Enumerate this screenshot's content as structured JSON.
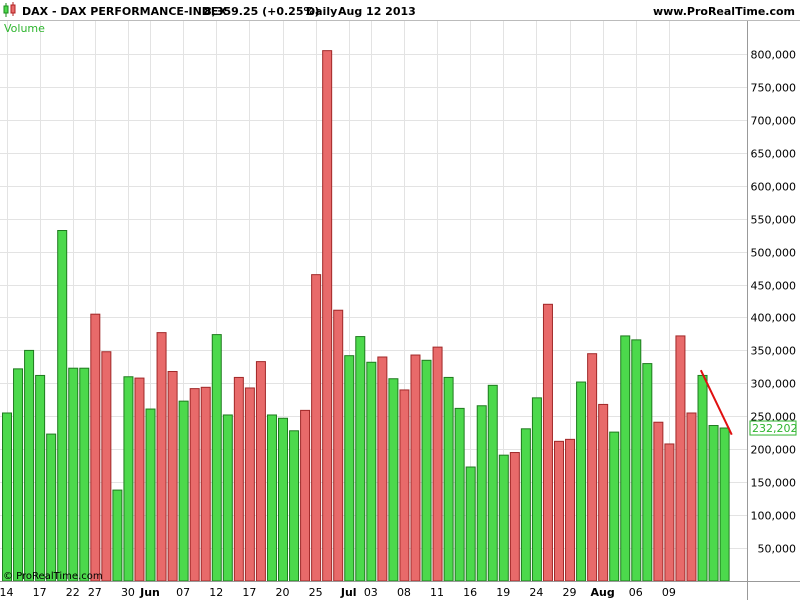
{
  "header": {
    "instrument": "DAX - DAX PERFORMANCE-INDEX",
    "price": "8,359.25 (+0.25%)",
    "period": "Daily",
    "date": "Aug 12 2013",
    "site": "www.ProRealTime.com"
  },
  "watermark": "© ProRealTime.com",
  "colors": {
    "up": "#4cd94c",
    "down": "#e86a6a",
    "trend": "#e01010",
    "grid": "#e3e3e3",
    "label_green": "#2fb52f"
  },
  "chart_data": {
    "type": "bar",
    "panel_label": "Volume",
    "ylim": [
      0,
      850000
    ],
    "y_ticks": [
      "50,000",
      "100,000",
      "150,000",
      "200,000",
      "250,000",
      "300,000",
      "350,000",
      "400,000",
      "450,000",
      "500,000",
      "550,000",
      "600,000",
      "650,000",
      "700,000",
      "750,000",
      "800,000"
    ],
    "y_tick_values": [
      50000,
      100000,
      150000,
      200000,
      250000,
      300000,
      350000,
      400000,
      450000,
      500000,
      550000,
      600000,
      650000,
      700000,
      750000,
      800000
    ],
    "x_tick_labels": [
      {
        "label": "14",
        "index": 0,
        "bold": false
      },
      {
        "label": "17",
        "index": 3,
        "bold": false
      },
      {
        "label": "22",
        "index": 6,
        "bold": false
      },
      {
        "label": "27",
        "index": 8,
        "bold": false
      },
      {
        "label": "30",
        "index": 11,
        "bold": false
      },
      {
        "label": "Jun",
        "index": 13,
        "bold": true
      },
      {
        "label": "07",
        "index": 16,
        "bold": false
      },
      {
        "label": "12",
        "index": 19,
        "bold": false
      },
      {
        "label": "17",
        "index": 22,
        "bold": false
      },
      {
        "label": "20",
        "index": 25,
        "bold": false
      },
      {
        "label": "25",
        "index": 28,
        "bold": false
      },
      {
        "label": "Jul",
        "index": 31,
        "bold": true
      },
      {
        "label": "03",
        "index": 33,
        "bold": false
      },
      {
        "label": "08",
        "index": 36,
        "bold": false
      },
      {
        "label": "11",
        "index": 39,
        "bold": false
      },
      {
        "label": "16",
        "index": 42,
        "bold": false
      },
      {
        "label": "19",
        "index": 45,
        "bold": false
      },
      {
        "label": "24",
        "index": 48,
        "bold": false
      },
      {
        "label": "29",
        "index": 51,
        "bold": false
      },
      {
        "label": "Aug",
        "index": 54,
        "bold": true
      },
      {
        "label": "06",
        "index": 57,
        "bold": false
      },
      {
        "label": "09",
        "index": 60,
        "bold": false
      }
    ],
    "values": [
      255000,
      322000,
      350000,
      312000,
      223000,
      532000,
      323000,
      323000,
      405000,
      348000,
      138000,
      310000,
      308000,
      261000,
      377000,
      318000,
      273000,
      292000,
      294000,
      374000,
      252000,
      309000,
      293000,
      333000,
      252000,
      247000,
      228000,
      259000,
      465000,
      805000,
      411000,
      342000,
      371000,
      332000,
      340000,
      307000,
      290000,
      343000,
      335000,
      355000,
      309000,
      262000,
      173000,
      266000,
      297000,
      191000,
      195000,
      231000,
      278000,
      420000,
      212000,
      215000,
      302000,
      345000,
      268000,
      226000,
      372000,
      366000,
      330000,
      241000,
      208000,
      372000,
      255000,
      312000,
      236000,
      232202
    ],
    "colors": [
      "up",
      "up",
      "up",
      "up",
      "up",
      "up",
      "up",
      "up",
      "down",
      "down",
      "up",
      "up",
      "down",
      "up",
      "down",
      "down",
      "up",
      "down",
      "down",
      "up",
      "up",
      "down",
      "down",
      "down",
      "up",
      "up",
      "up",
      "down",
      "down",
      "down",
      "down",
      "up",
      "up",
      "up",
      "down",
      "up",
      "down",
      "down",
      "up",
      "down",
      "up",
      "up",
      "up",
      "up",
      "up",
      "up",
      "down",
      "up",
      "up",
      "down",
      "down",
      "down",
      "up",
      "down",
      "down",
      "up",
      "up",
      "up",
      "up",
      "down",
      "down",
      "down",
      "down",
      "up",
      "up",
      "up"
    ],
    "last_value_label": "232,202",
    "last_value": 232202,
    "trendline": {
      "from": {
        "index": 63.3,
        "value": 320000
      },
      "to": {
        "index": 66.1,
        "value": 222000
      }
    },
    "grid": true
  }
}
